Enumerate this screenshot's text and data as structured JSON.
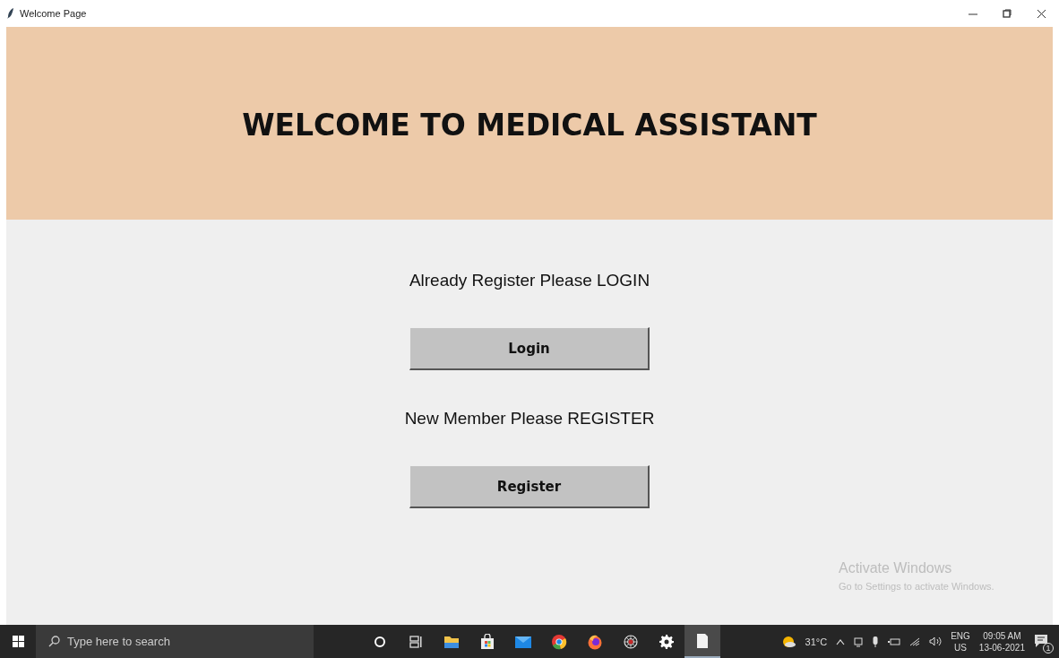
{
  "window": {
    "title": "Welcome Page"
  },
  "header": {
    "title": "WELCOME TO MEDICAL ASSISTANT"
  },
  "sections": [
    {
      "prompt": "Already Register Please LOGIN",
      "button": "Login"
    },
    {
      "prompt": "New Member Please REGISTER",
      "button": "Register"
    }
  ],
  "activation_notice": {
    "title": "Activate Windows",
    "subtitle": "Go to Settings to activate Windows."
  },
  "taskbar": {
    "search": {
      "placeholder": "Type here to search"
    },
    "apps": [
      {
        "kind": "cortana",
        "active": false
      },
      {
        "kind": "taskview",
        "active": false
      },
      {
        "kind": "folder",
        "active": false
      },
      {
        "kind": "store",
        "active": false
      },
      {
        "kind": "mail",
        "active": false
      },
      {
        "kind": "chrome",
        "active": false
      },
      {
        "kind": "firefox",
        "active": false
      },
      {
        "kind": "spider",
        "active": false
      },
      {
        "kind": "gear",
        "active": false
      },
      {
        "kind": "document",
        "active": true
      }
    ],
    "weather": "31°C",
    "language": "ENG",
    "region": "US",
    "time": "09:05 AM",
    "date": "13-06-2021",
    "notification_count": "1"
  }
}
